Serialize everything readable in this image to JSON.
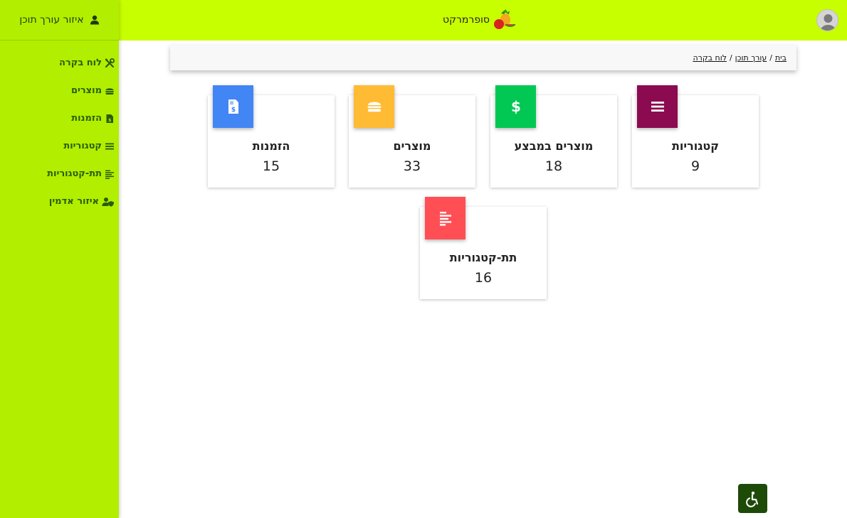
{
  "header": {
    "brand_name": "סופרמרקט",
    "brand_logo_icon": "fruit-basket-icon",
    "avatar_icon": "user-avatar-icon",
    "background": "#c8ff00"
  },
  "sidebar": {
    "title": "איזור עורך תוכן",
    "title_icon": "user-icon",
    "background": "#b2ee00",
    "items": [
      {
        "label": "לוח בקרה",
        "icon": "tools-icon"
      },
      {
        "label": "מוצרים",
        "icon": "burger-icon"
      },
      {
        "label": "הזמנות",
        "icon": "invoice-icon"
      },
      {
        "label": "קטגוריות",
        "icon": "list-icon"
      },
      {
        "label": "תת-קטגוריות",
        "icon": "align-left-icon"
      },
      {
        "label": "איזור אדמין",
        "icon": "user-shield-icon"
      }
    ]
  },
  "breadcrumb": {
    "items": [
      "בית",
      "עורך תוכן",
      "לוח בקרה"
    ],
    "separator": "/"
  },
  "cards": [
    {
      "title": "קטגוריות",
      "value": "9",
      "icon": "list-icon",
      "color": "#8b0a50"
    },
    {
      "title": "מוצרים במבצע",
      "value": "18",
      "icon": "dollar-icon",
      "color": "#00c853"
    },
    {
      "title": "מוצרים",
      "value": "33",
      "icon": "burger-icon",
      "color": "#ffbb33"
    },
    {
      "title": "הזמנות",
      "value": "15",
      "icon": "invoice-icon",
      "color": "#4285f4"
    },
    {
      "title": "תת-קטגוריות",
      "value": "16",
      "icon": "align-left-icon",
      "color": "#ff4f55"
    }
  ],
  "accessibility_button": {
    "icon": "wheelchair-icon",
    "color": "#1e4a08"
  }
}
